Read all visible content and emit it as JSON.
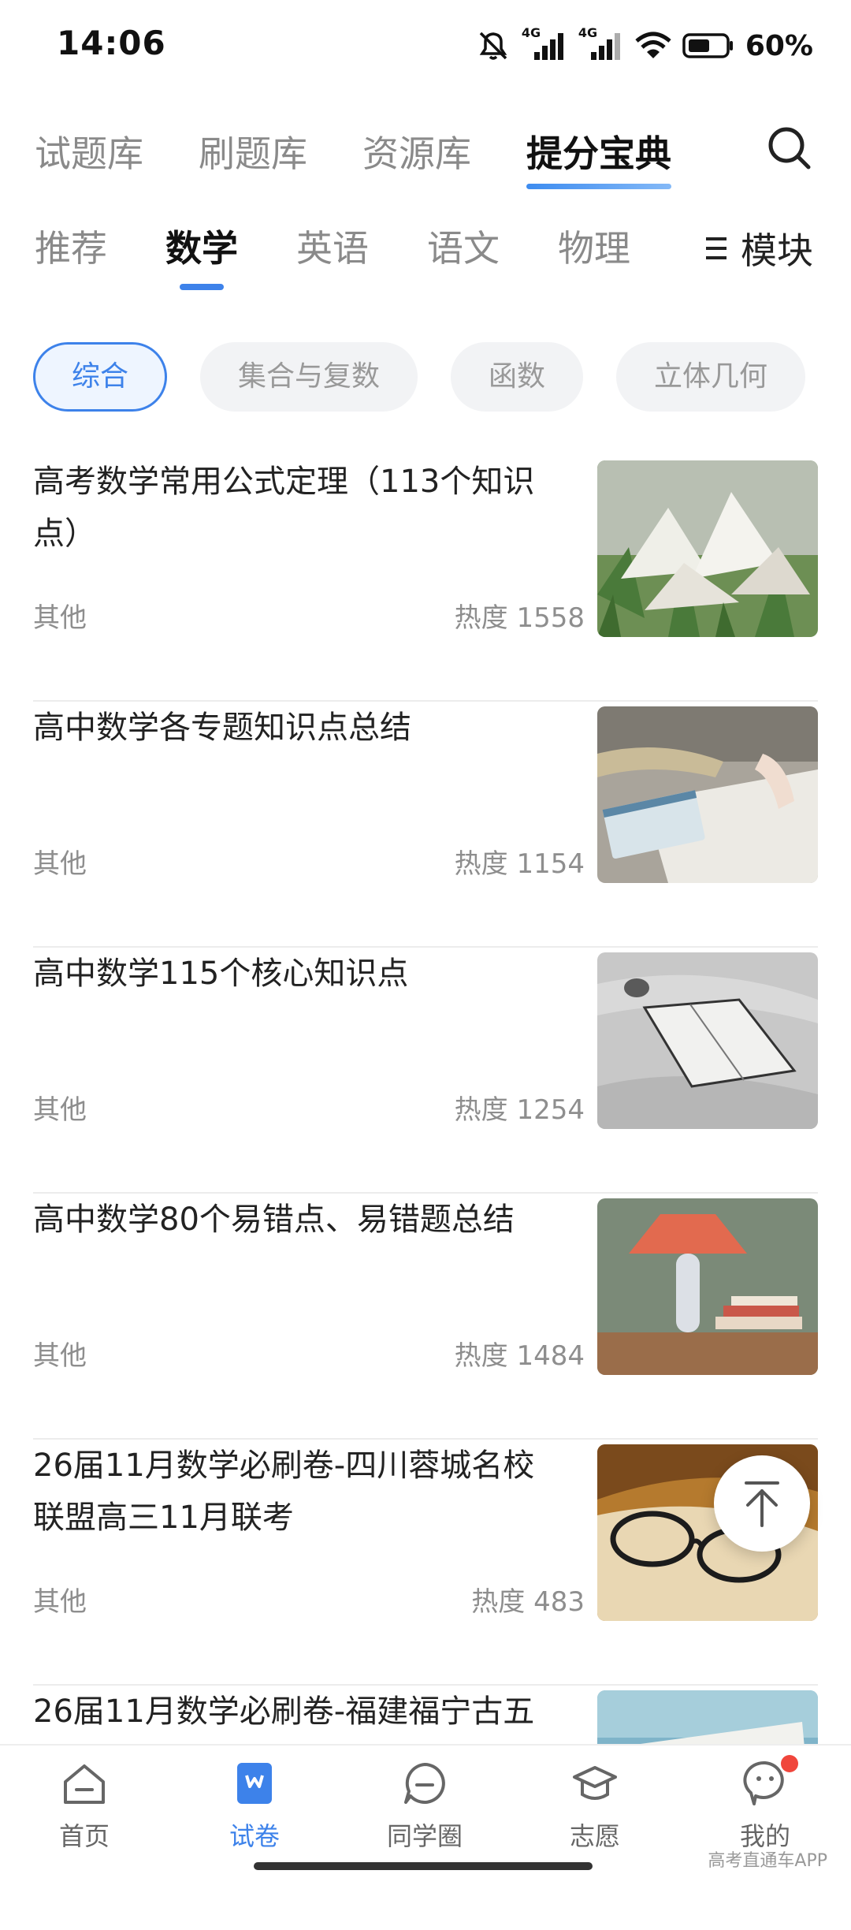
{
  "status_bar": {
    "time": "14:06",
    "network_1": "4G",
    "network_2": "4G",
    "battery": "60%"
  },
  "top_tabs": [
    {
      "label": "试题库"
    },
    {
      "label": "刷题库"
    },
    {
      "label": "资源库"
    },
    {
      "label": "提分宝典",
      "active": true
    }
  ],
  "subject_tabs": [
    {
      "label": "推荐"
    },
    {
      "label": "数学",
      "active": true
    },
    {
      "label": "英语"
    },
    {
      "label": "语文"
    },
    {
      "label": "物理"
    }
  ],
  "module_label": "模块",
  "chips": [
    {
      "label": "综合",
      "active": true
    },
    {
      "label": "集合与复数"
    },
    {
      "label": "函数"
    },
    {
      "label": "立体几何"
    }
  ],
  "articles": [
    {
      "title": "高考数学常用公式定理（113个知识点）",
      "tag": "其他",
      "hot": "热度 1558",
      "thumb": "open-books-in-grass"
    },
    {
      "title": "高中数学各专题知识点总结",
      "tag": "其他",
      "hot": "热度 1154",
      "thumb": "book-on-cloth"
    },
    {
      "title": "高中数学115个核心知识点",
      "tag": "其他",
      "hot": "热度 1254",
      "thumb": "notebook-on-sheets"
    },
    {
      "title": "高中数学80个易错点、易错题总结",
      "tag": "其他",
      "hot": "热度 1484",
      "thumb": "red-lamp-with-books"
    },
    {
      "title": "26届11月数学必刷卷-四川蓉城名校联盟高三11月联考",
      "tag": "其他",
      "hot": "热度 483",
      "thumb": "glasses-on-book"
    },
    {
      "title": "26届11月数学必刷卷-福建福宁古五",
      "tag": "",
      "hot": "",
      "thumb": "sea-and-paper"
    }
  ],
  "bottom_nav": [
    {
      "label": "首页",
      "icon": "home-icon"
    },
    {
      "label": "试卷",
      "icon": "paper-icon",
      "active": true
    },
    {
      "label": "同学圈",
      "icon": "chat-icon"
    },
    {
      "label": "志愿",
      "icon": "graduation-cap-icon"
    },
    {
      "label": "我的",
      "icon": "profile-icon",
      "badge": true
    }
  ],
  "watermark": "高考直通车APP",
  "colors": {
    "accent": "#3d82ea",
    "text": "#222222",
    "muted": "#8e8e8e",
    "badge": "#f0463c"
  }
}
